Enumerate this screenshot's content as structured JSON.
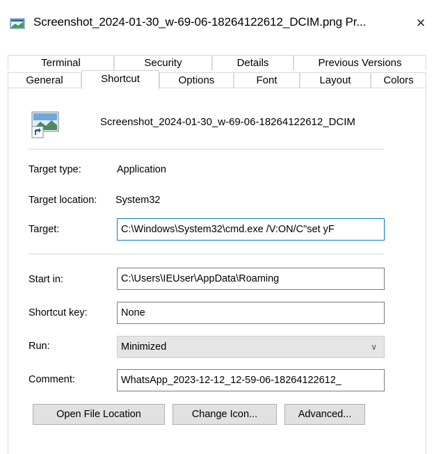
{
  "window": {
    "title": "Screenshot_2024-01-30_w-69-06-18264122612_DCIM.png Pr...",
    "close_icon": "×"
  },
  "tabs_row1": [
    {
      "label": "Terminal"
    },
    {
      "label": "Security"
    },
    {
      "label": "Details"
    },
    {
      "label": "Previous Versions"
    }
  ],
  "tabs_row2": [
    {
      "label": "General"
    },
    {
      "label": "Shortcut",
      "active": true
    },
    {
      "label": "Options"
    },
    {
      "label": "Font"
    },
    {
      "label": "Layout"
    },
    {
      "label": "Colors"
    }
  ],
  "header": {
    "icon": "image-file-shortcut-icon",
    "file_name": "Screenshot_2024-01-30_w-69-06-18264122612_DCIM"
  },
  "props": {
    "target_type_label": "Target type:",
    "target_type_value": "Application",
    "target_location_label": "Target location:",
    "target_location_value": "System32",
    "target_label": "Target:",
    "target_value": "C:\\Windows\\System32\\cmd.exe /V:ON/C\"set yF",
    "start_in_label": "Start in:",
    "start_in_value": "C:\\Users\\IEUser\\AppData\\Roaming",
    "shortcut_key_label": "Shortcut key:",
    "shortcut_key_value": "None",
    "run_label": "Run:",
    "run_value": "Minimized",
    "comment_label": "Comment:",
    "comment_value": "WhatsApp_2023-12-12_12-59-06-18264122612_"
  },
  "buttons": {
    "open_file_location": "Open File Location",
    "change_icon": "Change Icon...",
    "advanced": "Advanced..."
  },
  "colors": {
    "focus_border": "#0078d7",
    "button_bg": "#e1e1e1"
  }
}
